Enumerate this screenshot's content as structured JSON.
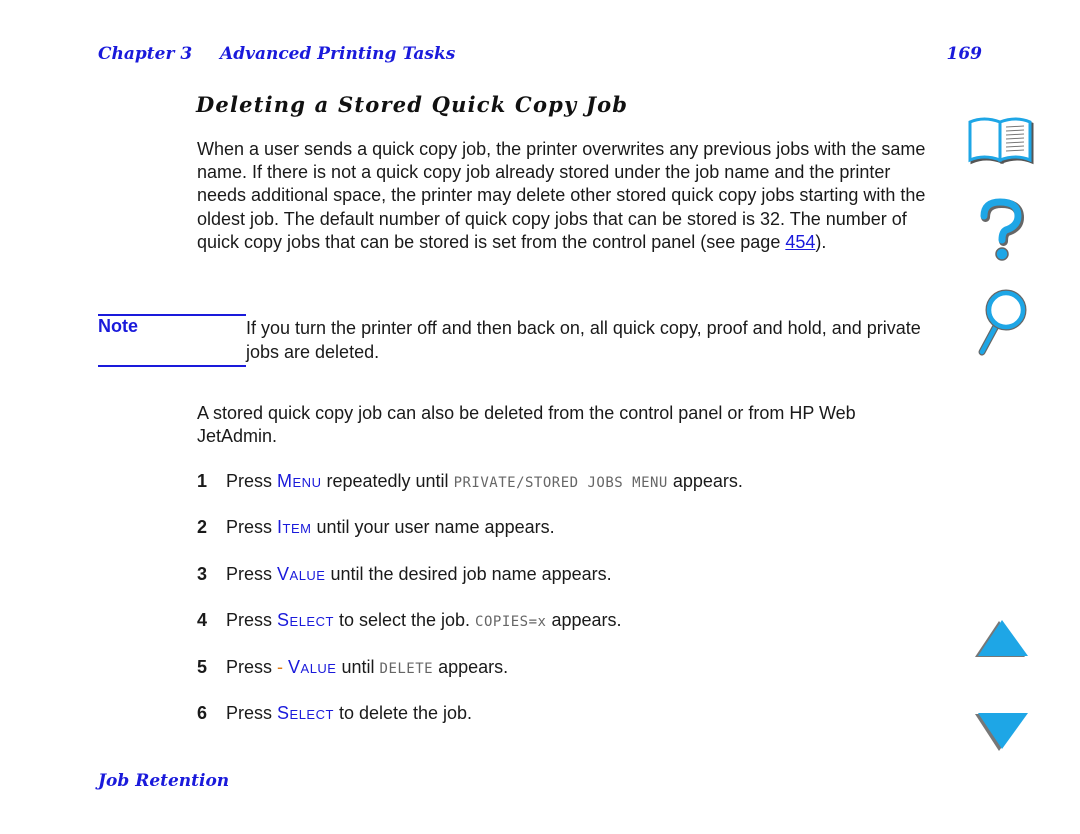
{
  "header": {
    "chapter": "Chapter 3",
    "section": "Advanced Printing Tasks",
    "page_number": "169"
  },
  "title": "Deleting a Stored Quick Copy Job",
  "intro": {
    "text_before_link": "When a user sends a quick copy job, the printer overwrites any previous jobs with the same name. If there is not a quick copy job already stored under the job name and the printer needs additional space, the printer may delete other stored quick copy jobs starting with the oldest job. The default number of quick copy jobs that can be stored is 32. The number of quick copy jobs that can be stored is set from the control panel (see page ",
    "link": "454",
    "text_after_link": ")."
  },
  "note": {
    "label": "Note",
    "text": "If you turn the printer off and then back on, all quick copy, proof and hold, and private jobs are deleted."
  },
  "paragraph2": "A stored quick copy job can also be deleted from the control panel or from HP Web JetAdmin.",
  "steps": [
    {
      "num": "1",
      "pre": "Press ",
      "key": "Menu",
      "mid": " repeatedly until ",
      "display": "PRIVATE/STORED JOBS MENU",
      "post": " appears."
    },
    {
      "num": "2",
      "pre": "Press ",
      "key": "Item",
      "mid": " until your user name appears.",
      "display": "",
      "post": ""
    },
    {
      "num": "3",
      "pre": "Press ",
      "key": "Value",
      "mid": " until the desired job name appears.",
      "display": "",
      "post": ""
    },
    {
      "num": "4",
      "pre": "Press ",
      "key": "Select",
      "mid": " to select the job. ",
      "display": "COPIES=x",
      "post": " appears."
    },
    {
      "num": "5",
      "pre": "Press ",
      "minus": "- ",
      "key": "Value",
      "mid": " until ",
      "display": "DELETE",
      "post": " appears."
    },
    {
      "num": "6",
      "pre": "Press ",
      "key": "Select",
      "mid": " to delete the job.",
      "display": "",
      "post": ""
    }
  ],
  "footer": "Job Retention",
  "icons": {
    "contents": "book-icon",
    "help": "question-mark-icon",
    "index": "magnifier-icon",
    "prev": "up-arrow-icon",
    "next": "down-arrow-icon"
  },
  "colors": {
    "accent_blue": "#1a1adb",
    "icon_cyan": "#1ea6e6",
    "minus_orange": "#e07a10"
  }
}
